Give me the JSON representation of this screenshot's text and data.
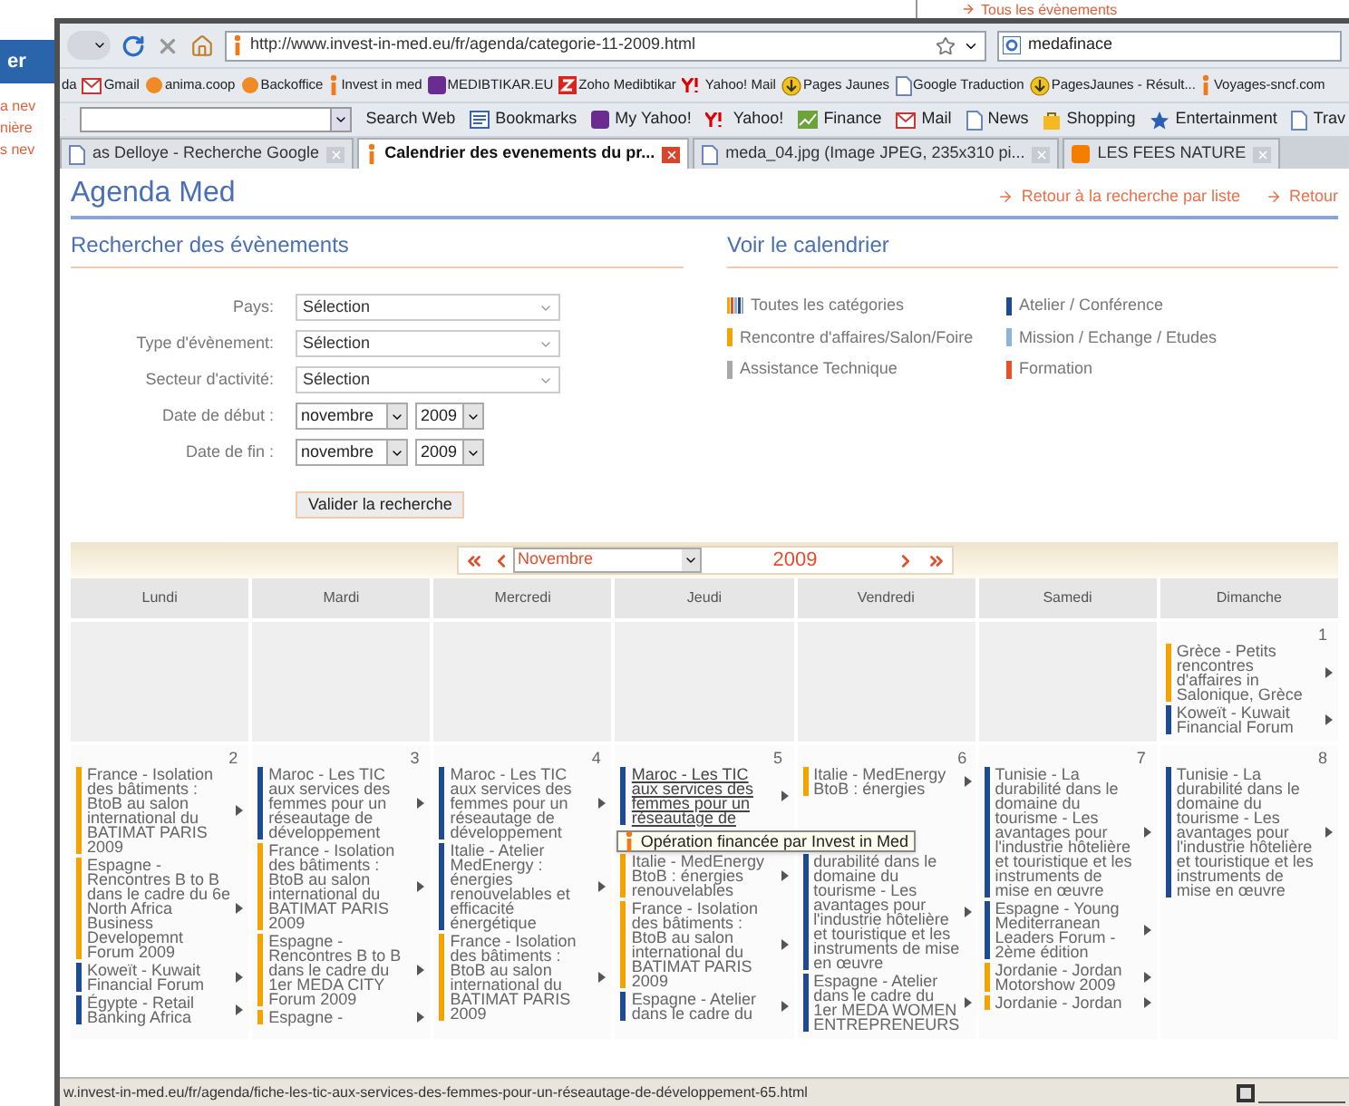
{
  "background_window": {
    "top_link": "Tous les évènements",
    "button": "er",
    "links": [
      "a nev",
      "nière",
      "s nev"
    ]
  },
  "browser": {
    "url": "http://www.invest-in-med.eu/fr/agenda/categorie-11-2009.html",
    "search_value": "medafinace",
    "bookmarks": [
      {
        "label": "da",
        "kind": "none"
      },
      {
        "label": "Gmail",
        "kind": "mail"
      },
      {
        "label": "anima.coop",
        "kind": "flame"
      },
      {
        "label": "Backoffice",
        "kind": "flame"
      },
      {
        "label": "Invest in med",
        "kind": "info"
      },
      {
        "label": "MEDIBTIKAR.EU",
        "kind": "purple"
      },
      {
        "label": "Zoho Medibtikar",
        "kind": "red"
      },
      {
        "label": "Yahoo! Mail",
        "kind": "yahoo"
      },
      {
        "label": "Pages Jaunes",
        "kind": "download"
      },
      {
        "label": "Google Traduction",
        "kind": "page"
      },
      {
        "label": "PagesJaunes - Résult...",
        "kind": "download"
      },
      {
        "label": "Voyages-sncf.com",
        "kind": "info"
      }
    ],
    "toolbar": [
      {
        "label": "Search Web",
        "kind": "plain"
      },
      {
        "label": "Bookmarks",
        "kind": "book"
      },
      {
        "label": "My Yahoo!",
        "kind": "purple"
      },
      {
        "label": "Yahoo!",
        "kind": "yahoo"
      },
      {
        "label": "Finance",
        "kind": "chart"
      },
      {
        "label": "Mail",
        "kind": "mail"
      },
      {
        "label": "News",
        "kind": "page"
      },
      {
        "label": "Shopping",
        "kind": "bag"
      },
      {
        "label": "Entertainment",
        "kind": "star"
      },
      {
        "label": "Trav",
        "kind": "page"
      }
    ],
    "tabs": [
      {
        "title": "as Delloye - Recherche Google",
        "selected": false,
        "kind": "page"
      },
      {
        "title": "Calendrier des evenements du pr...",
        "selected": true,
        "kind": "info"
      },
      {
        "title": "meda_04.jpg (Image JPEG, 235x310 pi...",
        "selected": false,
        "kind": "page"
      },
      {
        "title": "LES FEES NATURE",
        "selected": false,
        "kind": "blog"
      }
    ],
    "status_text": "w.invest-in-med.eu/fr/agenda/fiche-les-tic-aux-services-des-femmes-pour-un-réseautage-de-développement-65.html"
  },
  "page": {
    "title": "Agenda Med",
    "top_links": [
      "Retour à la recherche par liste",
      "Retour"
    ],
    "search": {
      "heading": "Rechercher des évènements",
      "fields": [
        {
          "kind": "select",
          "label": "Pays:",
          "value": "Sélection"
        },
        {
          "kind": "select",
          "label": "Type d'évènement:",
          "value": "Sélection"
        },
        {
          "kind": "select",
          "label": "Secteur d'activité:",
          "value": "Sélection"
        },
        {
          "kind": "date",
          "label": "Date de début :",
          "month": "novembre",
          "year": "2009"
        },
        {
          "kind": "date",
          "label": "Date de fin :",
          "month": "novembre",
          "year": "2009"
        }
      ],
      "submit": "Valider la recherche"
    },
    "legend": {
      "heading": "Voir le calendrier",
      "items": [
        {
          "kind": "all",
          "label": "Toutes les catégories"
        },
        {
          "kind": "category",
          "label": "Atelier / Conférence",
          "color": "#1f4a8f"
        },
        {
          "kind": "category",
          "label": "Rencontre d'affaires/Salon/Foire",
          "color": "#f5a300"
        },
        {
          "kind": "category",
          "label": "Mission / Echange / Etudes",
          "color": "#8fb4d8"
        },
        {
          "kind": "category",
          "label": "Assistance Technique",
          "color": "#a8a8a8"
        },
        {
          "kind": "category",
          "label": "Formation",
          "color": "#e8502a"
        }
      ]
    }
  },
  "calendar": {
    "month": "Novembre",
    "year": "2009",
    "weekdays": [
      "Lundi",
      "Mardi",
      "Mercredi",
      "Jeudi",
      "Vendredi",
      "Samedi",
      "Dimanche"
    ],
    "weeks": [
      {
        "days": [
          {
            "kind": "outside"
          },
          {
            "kind": "outside"
          },
          {
            "kind": "outside"
          },
          {
            "kind": "outside"
          },
          {
            "kind": "outside"
          },
          {
            "kind": "outside"
          },
          {
            "kind": "day",
            "number": "1",
            "events": [
              {
                "text": "Grèce - Petits rencontres d'affaires in Salonique, Grèce",
                "color": "#f5a300"
              },
              {
                "text": "Koweït - Kuwait Financial Forum",
                "color": "#1f4a8f"
              }
            ]
          }
        ]
      },
      {
        "days": [
          {
            "kind": "day",
            "number": "2",
            "events": [
              {
                "text": "France - Isolation des bâtiments : BtoB au salon international du BATIMAT PARIS 2009",
                "color": "#f5a300"
              },
              {
                "text": "Espagne - Rencontres B to B dans le cadre du 6e North Africa Business Developemnt Forum 2009",
                "color": "#f5a300"
              },
              {
                "text": "Koweït - Kuwait Financial Forum",
                "color": "#1f4a8f"
              },
              {
                "text": "Égypte - Retail Banking Africa",
                "color": "#1f4a8f"
              }
            ]
          },
          {
            "kind": "day",
            "number": "3",
            "events": [
              {
                "text": "Maroc - Les TIC aux services des femmes pour un réseautage de développement",
                "color": "#1f4a8f"
              },
              {
                "text": "France - Isolation des bâtiments : BtoB au salon international du BATIMAT PARIS 2009",
                "color": "#f5a300"
              },
              {
                "text": "Espagne - Rencontres B to B dans le cadre du 1er MEDA CITY Forum 2009",
                "color": "#f5a300"
              },
              {
                "text": "Espagne -",
                "color": "#f5a300"
              }
            ]
          },
          {
            "kind": "day",
            "number": "4",
            "events": [
              {
                "text": "Maroc - Les TIC aux services des femmes pour un réseautage de développement",
                "color": "#1f4a8f"
              },
              {
                "text": "Italie - Atelier MedEnergy : énergies renouvelables et efficacité énergétique",
                "color": "#1f4a8f"
              },
              {
                "text": "France - Isolation des bâtiments : BtoB au salon international du BATIMAT PARIS 2009",
                "color": "#f5a300"
              }
            ]
          },
          {
            "kind": "day",
            "number": "5",
            "tooltip": "Opération financée par Invest in Med",
            "events": [
              {
                "text": "Maroc - Les TIC aux services des femmes pour un réseautage de",
                "color": "#1f4a8f",
                "hovered": true
              },
              {
                "text": "Italie - MedEnergy BtoB : énergies renouvelables",
                "color": "#f5a300",
                "hovered": false
              },
              {
                "text": "France - Isolation des bâtiments : BtoB au salon international du BATIMAT PARIS 2009",
                "color": "#f5a300",
                "hovered": false
              },
              {
                "text": "Espagne - Atelier dans le cadre du",
                "color": "#1f4a8f",
                "hovered": false
              }
            ]
          },
          {
            "kind": "day",
            "number": "6",
            "events": [
              {
                "text": "Italie - MedEnergy BtoB : énergies",
                "color": "#f5a300"
              },
              {
                "text": "durabilité dans le domaine du tourisme - Les avantages pour l'industrie hôtelière et touristique et les instruments de mise en œuvre",
                "color": "#1f4a8f"
              },
              {
                "text": "Espagne - Atelier dans le cadre du 1er MEDA WOMEN ENTREPRENEURS",
                "color": "#1f4a8f"
              }
            ]
          },
          {
            "kind": "day",
            "number": "7",
            "events": [
              {
                "text": "Tunisie - La durabilité dans le domaine du tourisme - Les avantages pour l'industrie hôtelière et touristique et les instruments de mise en œuvre",
                "color": "#1f4a8f"
              },
              {
                "text": "Espagne - Young Mediterranean Leaders Forum - 2ème édition",
                "color": "#1f4a8f"
              },
              {
                "text": "Jordanie - Jordan Motorshow 2009",
                "color": "#f5a300"
              },
              {
                "text": "Jordanie - Jordan",
                "color": "#f5a300"
              }
            ]
          },
          {
            "kind": "day",
            "number": "8",
            "events": [
              {
                "text": "Tunisie - La durabilité dans le domaine du tourisme - Les avantages pour l'industrie hôtelière et touristique et les instruments de mise en œuvre",
                "color": "#1f4a8f"
              }
            ]
          }
        ]
      }
    ]
  }
}
